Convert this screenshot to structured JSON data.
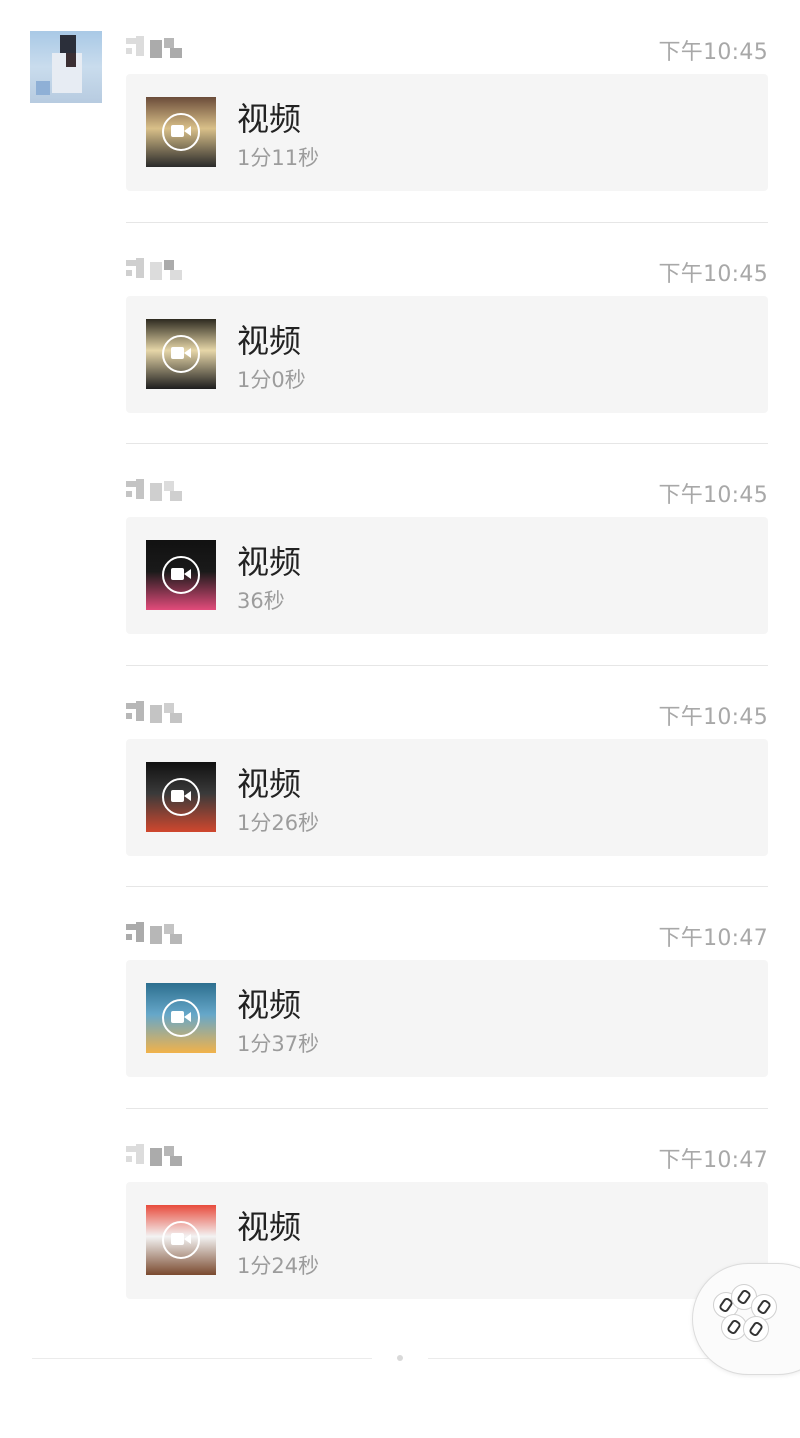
{
  "entries": [
    {
      "time": "下午10:45",
      "title": "视频",
      "duration": "1分11秒",
      "thumb_colors": [
        "#6b4c3a",
        "#d9c089",
        "#2a2a2a"
      ]
    },
    {
      "time": "下午10:45",
      "title": "视频",
      "duration": "1分0秒",
      "thumb_colors": [
        "#2d2a20",
        "#e6d6a8",
        "#1e1e1e"
      ]
    },
    {
      "time": "下午10:45",
      "title": "视频",
      "duration": "36秒",
      "thumb_colors": [
        "#111111",
        "#1a1a1a",
        "#e24b7b"
      ]
    },
    {
      "time": "下午10:45",
      "title": "视频",
      "duration": "1分26秒",
      "thumb_colors": [
        "#111111",
        "#3a3a3a",
        "#d0472e"
      ]
    },
    {
      "time": "下午10:47",
      "title": "视频",
      "duration": "1分37秒",
      "thumb_colors": [
        "#2d6f8f",
        "#66a7c9",
        "#f1b24a"
      ]
    },
    {
      "time": "下午10:47",
      "title": "视频",
      "duration": "1分24秒",
      "thumb_colors": [
        "#e84b3c",
        "#f3f3f3",
        "#7a4a2f"
      ]
    }
  ],
  "icons": {
    "avatar": "user-avatar",
    "play": "video-play-icon",
    "float_button": "link-icon"
  }
}
